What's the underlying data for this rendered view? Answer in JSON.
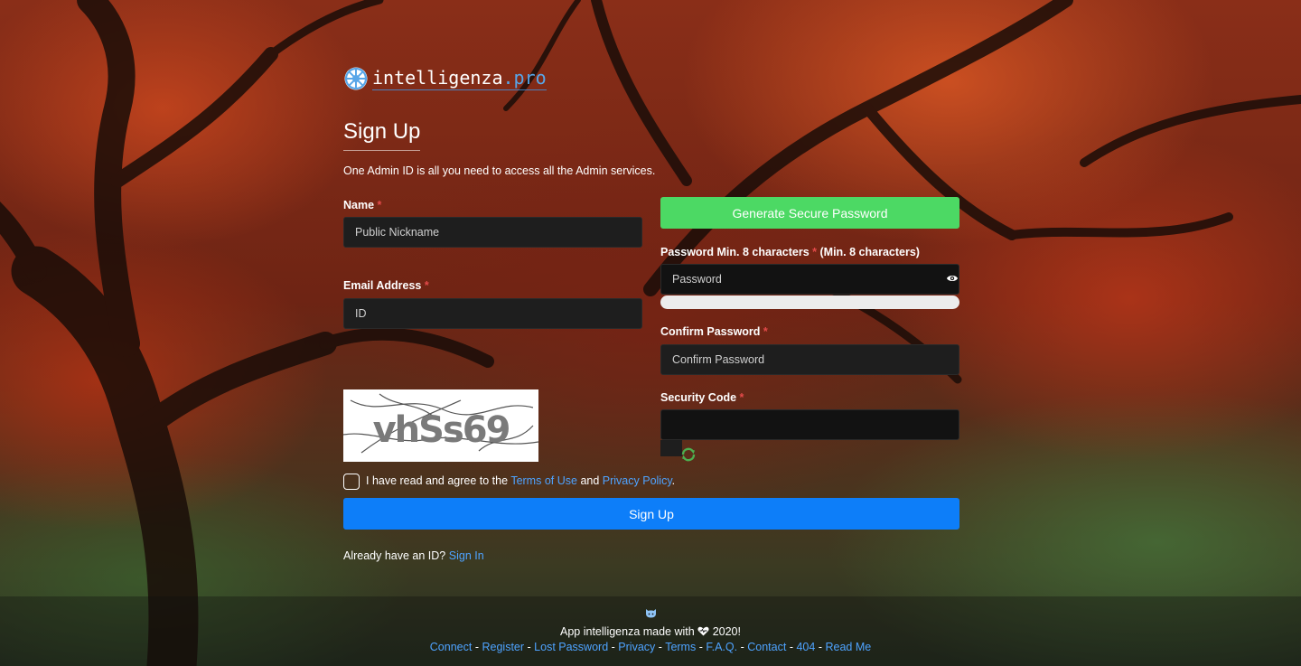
{
  "brand": {
    "name_main": "intelligenza",
    "name_tld": ".pro",
    "accent": "#58a6e8",
    "logo_icon": "dharma-wheel-icon"
  },
  "page": {
    "title": "Sign Up",
    "subtitle": "One Admin ID is all you need to access all the Admin services.",
    "required_mark": "*"
  },
  "form": {
    "name_label": "Name",
    "name_placeholder": "Public Nickname",
    "email_label": "Email Address",
    "email_placeholder": "ID",
    "generate_label": "Generate Secure Password",
    "password_label": "Password Min. 8 characters",
    "password_hint": "(Min. 8 characters)",
    "password_placeholder": "Password",
    "show_password_icon": "eye-icon",
    "confirm_label": "Confirm Password",
    "confirm_placeholder": "Confirm Password",
    "security_label": "Security Code",
    "captcha_text": "vhSs69",
    "refresh_icon": "refresh-icon",
    "agree_prefix": "I have read and agree to the",
    "terms_link": "Terms of Use",
    "agree_and": "and",
    "privacy_link": "Privacy Policy",
    "agree_suffix": ".",
    "submit_label": "Sign Up",
    "have_id_text": "Already have an ID?",
    "sign_in_link": "Sign In"
  },
  "colors": {
    "generate_button": "#4cd964",
    "signup_button": "#0d7ef9",
    "link": "#4ea3ff",
    "required": "#e34a4a"
  },
  "footer": {
    "icon": "github-cat-icon",
    "made_prefix": "App intelligenza made with",
    "heart_icon": "heart-icon",
    "made_suffix": "2020!",
    "links": [
      "Connect",
      "Register",
      "Lost Password",
      "Privacy",
      "Terms",
      "F.A.Q.",
      "Contact",
      "404",
      "Read Me"
    ],
    "separator": "-"
  }
}
